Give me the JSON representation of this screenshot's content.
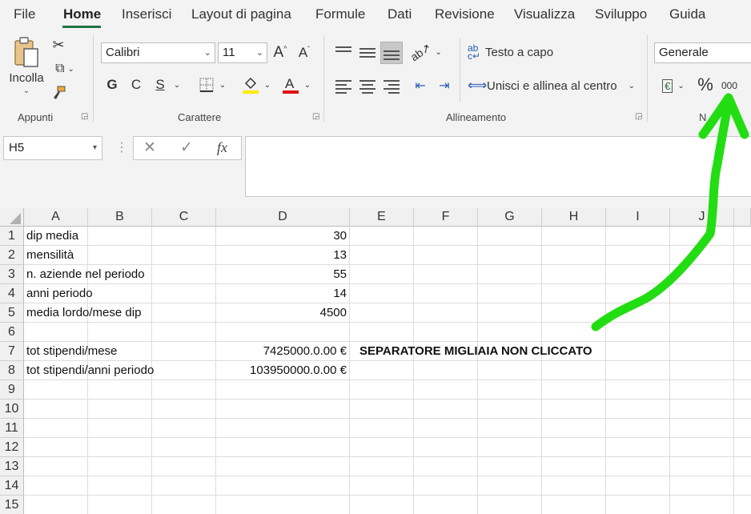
{
  "menu": {
    "tabs": [
      "File",
      "Home",
      "Inserisci",
      "Layout di pagina",
      "Formule",
      "Dati",
      "Revisione",
      "Visualizza",
      "Sviluppo",
      "Guida"
    ],
    "active": "Home"
  },
  "ribbon": {
    "clipboard": {
      "paste_label": "Incolla",
      "group_label": "Appunti"
    },
    "font": {
      "name": "Calibri",
      "size": "11",
      "bold": "G",
      "italic": "C",
      "underline": "S",
      "group_label": "Carattere"
    },
    "alignment": {
      "wrap_text": "Testo a capo",
      "merge_center": "Unisci e allinea al centro",
      "group_label": "Allineamento",
      "wrap_icon_text": "ab",
      "wrap_icon_text2": "c"
    },
    "number": {
      "format": "Generale",
      "percent": "%",
      "thousands": "000",
      "group_label_fragment": "N"
    }
  },
  "formula_bar": {
    "name_box": "H5",
    "formula": ""
  },
  "grid": {
    "columns": [
      "A",
      "B",
      "C",
      "D",
      "E",
      "F",
      "G",
      "H",
      "I",
      "J"
    ],
    "rows": [
      "1",
      "2",
      "3",
      "4",
      "5",
      "6",
      "7",
      "8",
      "9",
      "10",
      "11",
      "12",
      "13",
      "14",
      "15"
    ],
    "cells": {
      "A1": "dip media",
      "D1": "30",
      "A2": "mensilità",
      "D2": "13",
      "A3": "n. aziende nel periodo",
      "D3": "55",
      "A4": "anni periodo",
      "D4": "14",
      "A5": "media lordo/mese dip",
      "D5": "4500",
      "A7": "tot stipendi/mese",
      "D7": "7425000.0.00 €",
      "A8": "tot stipendi/anni periodo",
      "D8": "103950000.0.00 €",
      "E7": "SEPARATORE MIGLIAIA NON CLICCATO"
    }
  },
  "annotation": {
    "arrow_color": "#22dd11",
    "points_to": "thousands-separator-button"
  }
}
